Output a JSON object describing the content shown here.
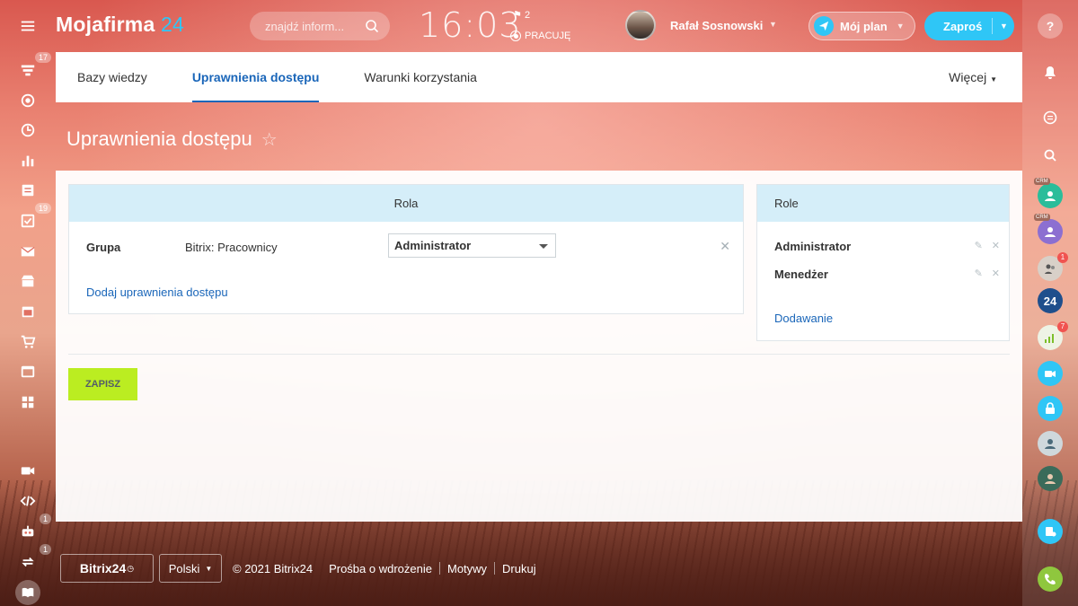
{
  "header": {
    "logo_text": "Mojafirma",
    "logo_num": "24",
    "search_placeholder": "znajdź inform...",
    "clock": "16:03",
    "flag_count": "2",
    "work_status": "PRACUJĘ",
    "user_name": "Rafał Sosnowski",
    "plan_label": "Mój plan",
    "invite_label": "Zaproś"
  },
  "left_sidebar": {
    "badges": {
      "feed": "17",
      "tasks": "19",
      "bot": "1",
      "sync": "1"
    }
  },
  "right_sidebar": {
    "crm_label": "CRM",
    "badges": {
      "user_group": "1",
      "chart": "7"
    },
    "b24_label": "24"
  },
  "nav": {
    "tabs": [
      {
        "label": "Bazy wiedzy"
      },
      {
        "label": "Uprawnienia dostępu"
      },
      {
        "label": "Warunki korzystania"
      }
    ],
    "more_label": "Więcej"
  },
  "page": {
    "title": "Uprawnienia dostępu",
    "role_column_header": "Rola",
    "access_row": {
      "type_label": "Grupa",
      "value": "Bitrix: Pracownicy",
      "selected_role": "Administrator"
    },
    "add_access_link": "Dodaj uprawnienia dostępu",
    "roles_header": "Role",
    "roles": [
      {
        "name": "Administrator"
      },
      {
        "name": "Menedżer"
      }
    ],
    "add_role_link": "Dodawanie",
    "save_button": "ZAPISZ"
  },
  "footer": {
    "brand": "Bitrix24",
    "language": "Polski",
    "copyright": "© 2021 Bitrix24",
    "links": [
      "Prośba o wdrożenie",
      "Motywy",
      "Drukuj"
    ]
  },
  "colors": {
    "accent": "#2fc6f6",
    "link": "#1a66b9",
    "save": "#bbed21",
    "table_header": "#d5eef9"
  }
}
